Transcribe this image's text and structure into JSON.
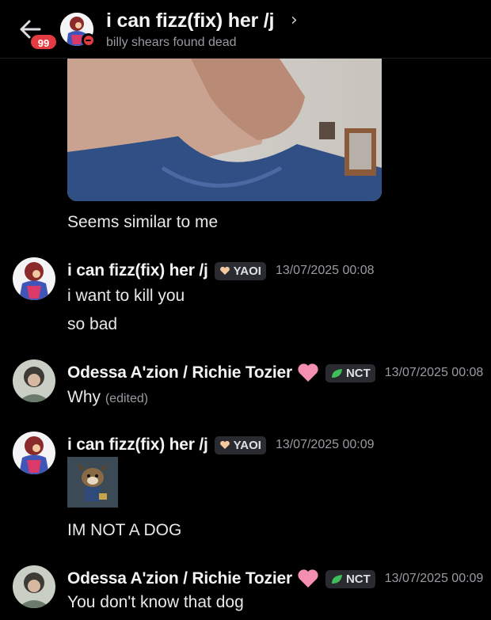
{
  "header": {
    "title": "i can fizz(fix) her /j",
    "subtitle": "billy shears found dead",
    "unread_badge": "99",
    "chevron": "›"
  },
  "messages": [
    {
      "id": "m0",
      "text": "Seems similar to me"
    },
    {
      "id": "m1",
      "author": "i can fizz(fix) her /j",
      "tag": "YAOI",
      "tag_icon": "heart-hands-icon",
      "timestamp": "13/07/2025 00:08",
      "lines": [
        "i want to kill you",
        "so bad"
      ]
    },
    {
      "id": "m2",
      "author": "Odessa A'zion / Richie Tozier",
      "tag": "NCT",
      "tag_icon": "leaf-icon",
      "timestamp": "13/07/2025 00:08",
      "text": "Why",
      "edited": "(edited)"
    },
    {
      "id": "m3",
      "author": "i can fizz(fix) her /j",
      "tag": "YAOI",
      "tag_icon": "heart-hands-icon",
      "timestamp": "13/07/2025 00:09",
      "text": "IM NOT A DOG"
    },
    {
      "id": "m4",
      "author": "Odessa A'zion / Richie Tozier",
      "tag": "NCT",
      "tag_icon": "leaf-icon",
      "timestamp": "13/07/2025 00:09",
      "text": "You don't know that dog"
    }
  ],
  "colors": {
    "background": "#000000",
    "badge": "#e23b41",
    "tag_bg": "#2a2b30",
    "muted": "#9a9aa1",
    "heart": "#f48fb1",
    "leaf": "#3fbf5a"
  }
}
